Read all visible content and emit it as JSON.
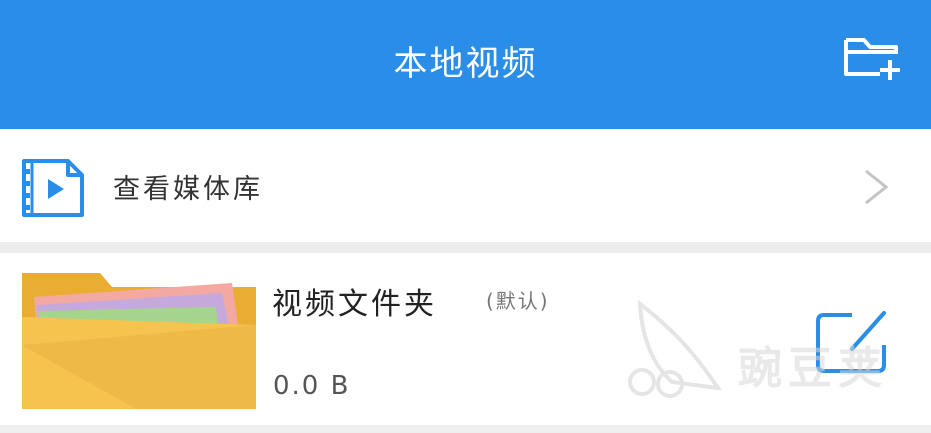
{
  "header": {
    "title": "本地视频",
    "new_folder_icon": "folder-plus-icon"
  },
  "media_library": {
    "label": "查看媒体库",
    "icon": "video-file-icon",
    "chevron_icon": "chevron-right-icon"
  },
  "folder": {
    "name": "视频文件夹",
    "default_tag": "(默认)",
    "size": "0.0 B",
    "thumb_icon": "folder-icon",
    "edit_icon": "edit-icon"
  },
  "watermark": {
    "text": "豌豆荚"
  },
  "colors": {
    "header_bg": "#2a8ee8",
    "accent": "#2a8ee8",
    "folder_yellow": "#f5c24c"
  }
}
